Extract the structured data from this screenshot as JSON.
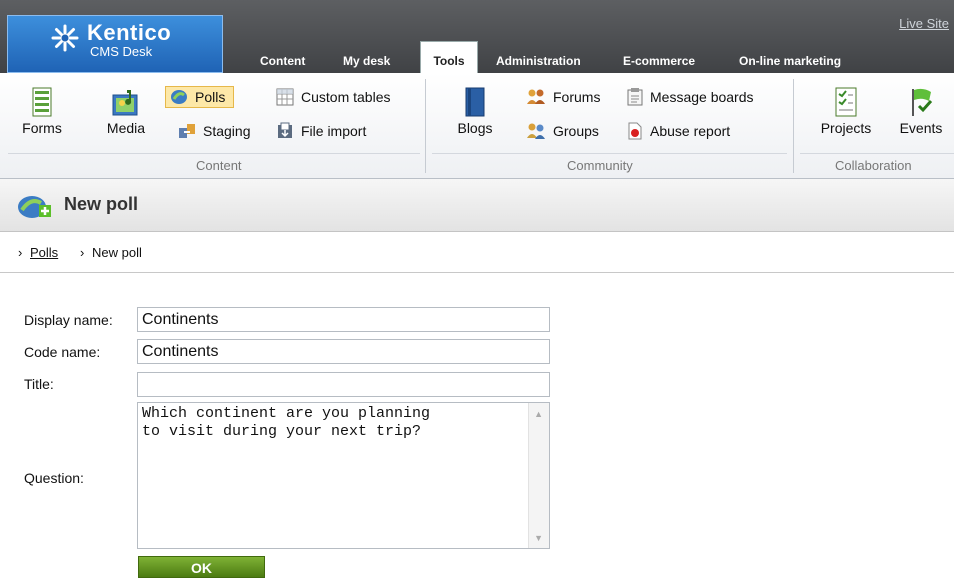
{
  "header": {
    "logo_title": "Kentico",
    "logo_subtitle": "CMS Desk",
    "live_site": "Live Site",
    "tabs": [
      {
        "label": "Content"
      },
      {
        "label": "My desk"
      },
      {
        "label": "Tools",
        "active": true
      },
      {
        "label": "Administration"
      },
      {
        "label": "E-commerce"
      },
      {
        "label": "On-line marketing"
      }
    ]
  },
  "ribbon": {
    "groups": [
      {
        "label": "Content",
        "items": [
          "Forms",
          "Media",
          "Polls",
          "Staging",
          "Custom tables",
          "File import"
        ]
      },
      {
        "label": "Community",
        "items": [
          "Blogs",
          "Forums",
          "Groups",
          "Message boards",
          "Abuse report"
        ]
      },
      {
        "label": "Collaboration",
        "items": [
          "Projects",
          "Events"
        ]
      }
    ],
    "selected_item": "Polls"
  },
  "page": {
    "title": "New poll",
    "breadcrumb": {
      "parent": "Polls",
      "current": "New poll"
    }
  },
  "form": {
    "display_name_label": "Display name:",
    "display_name_value": "Continents",
    "code_name_label": "Code name:",
    "code_name_value": "Continents",
    "title_label": "Title:",
    "title_value": "",
    "question_label": "Question:",
    "question_value": "Which continent are you planning\nto visit during your next trip?",
    "ok_label": "OK"
  },
  "colors": {
    "header_bg": "#4b4d50",
    "logo_bg": "#2a75c9",
    "selected_bg": "#fde8a8",
    "ok_button": "#5e8f1c"
  }
}
